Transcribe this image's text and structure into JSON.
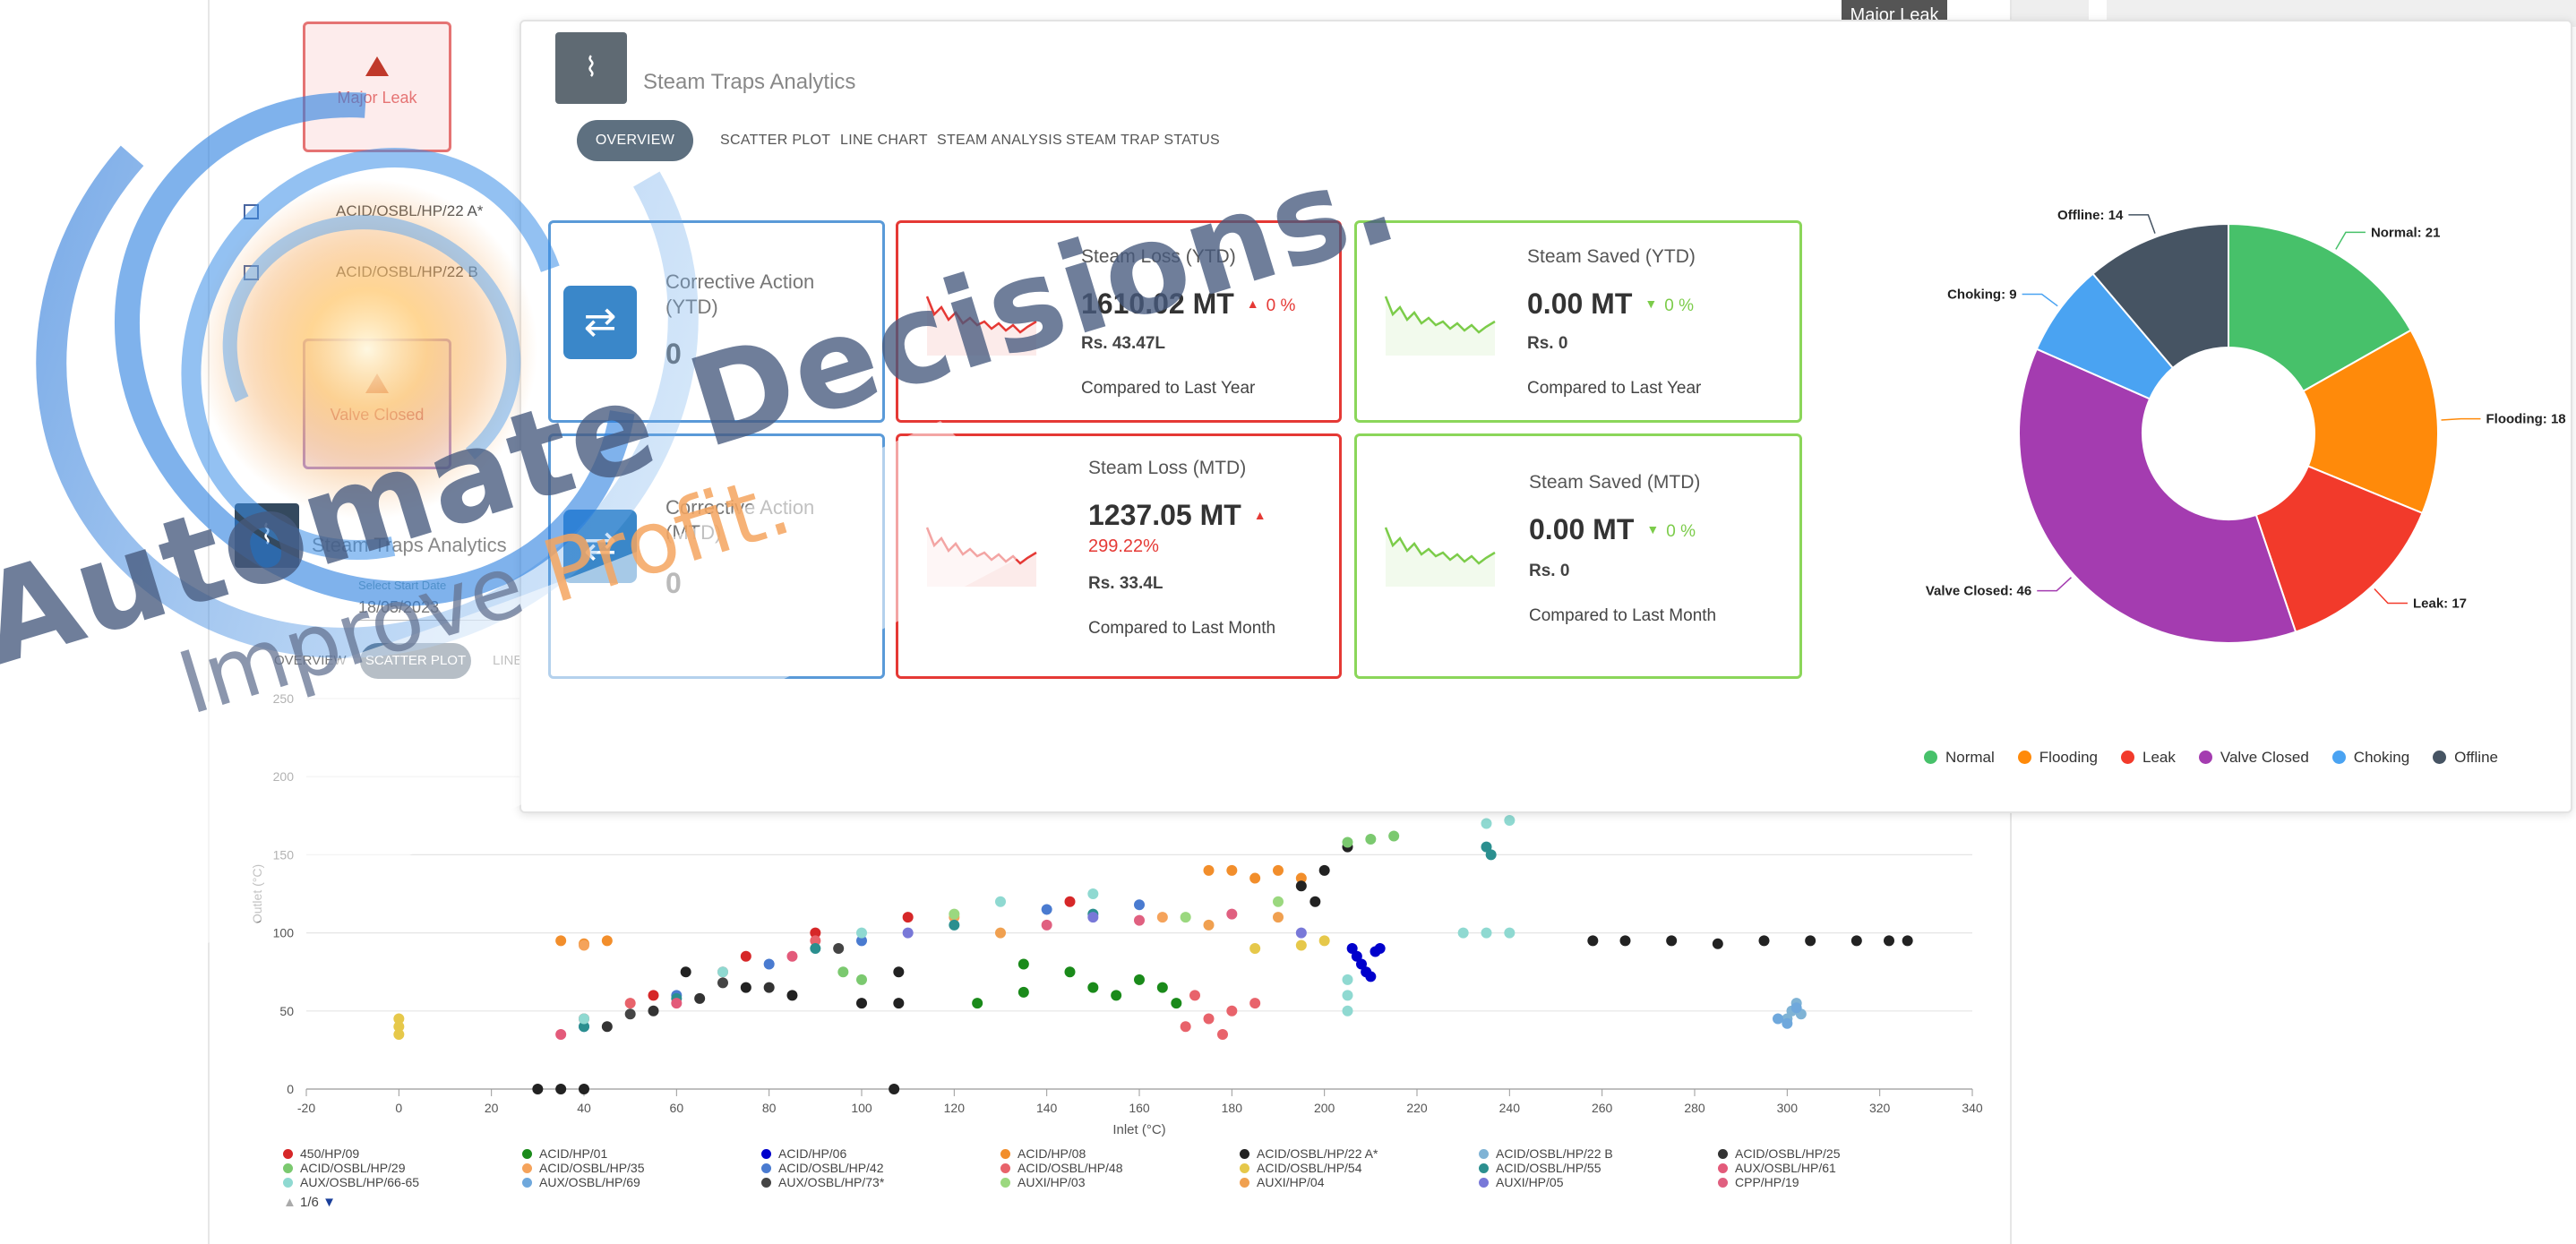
{
  "background_window": {
    "top_tag": "Major Leak",
    "cards": [
      {
        "label": "Major Leak"
      },
      {
        "label": "Valve Closed"
      }
    ],
    "trap_rows": [
      "ACID/OSBL/HP/22 A*",
      "ACID/OSBL/HP/22 B"
    ],
    "analytics_title": "Steam Traps Analytics",
    "start_date_label": "Select Start Date",
    "start_date_value": "18/05/2023",
    "tabs": [
      "OVERVIEW",
      "SCATTER PLOT",
      "LINE"
    ]
  },
  "chart_data": [
    {
      "type": "scatter",
      "title": "",
      "xlabel": "Inlet (°C)",
      "ylabel": "Outlet (°C)",
      "xlim": [
        -20,
        340
      ],
      "ylim": [
        0,
        250
      ],
      "x_ticks": [
        -20,
        0,
        20,
        40,
        60,
        80,
        100,
        120,
        140,
        160,
        180,
        200,
        220,
        240,
        260,
        280,
        300,
        320,
        340
      ],
      "y_ticks": [
        0,
        50,
        100,
        150,
        200,
        250
      ],
      "grid": true,
      "legend_page": "1/6",
      "series": [
        {
          "name": "450/HP/09",
          "color": "#d62728",
          "points": [
            [
              40,
              45
            ],
            [
              55,
              60
            ],
            [
              75,
              85
            ],
            [
              90,
              100
            ],
            [
              110,
              110
            ],
            [
              145,
              120
            ]
          ]
        },
        {
          "name": "ACID/HP/01",
          "color": "#1a8a1a",
          "points": [
            [
              135,
              80
            ],
            [
              145,
              75
            ],
            [
              150,
              65
            ],
            [
              155,
              60
            ],
            [
              160,
              70
            ],
            [
              165,
              65
            ],
            [
              168,
              55
            ],
            [
              135,
              62
            ],
            [
              125,
              55
            ]
          ]
        },
        {
          "name": "ACID/HP/06",
          "color": "#0000cc",
          "points": [
            [
              206,
              90
            ],
            [
              207,
              85
            ],
            [
              208,
              80
            ],
            [
              209,
              75
            ],
            [
              210,
              72
            ],
            [
              211,
              88
            ],
            [
              212,
              90
            ]
          ]
        },
        {
          "name": "ACID/HP/08",
          "color": "#f28e2b",
          "points": [
            [
              175,
              140
            ],
            [
              180,
              140
            ],
            [
              185,
              135
            ],
            [
              190,
              140
            ],
            [
              195,
              135
            ],
            [
              35,
              95
            ],
            [
              40,
              93
            ],
            [
              45,
              95
            ]
          ]
        },
        {
          "name": "ACID/OSBL/HP/22 A*",
          "color": "#222222",
          "points": [
            [
              30,
              0
            ],
            [
              35,
              0
            ],
            [
              40,
              0
            ],
            [
              107,
              0
            ],
            [
              62,
              75
            ],
            [
              75,
              65
            ],
            [
              85,
              60
            ],
            [
              100,
              55
            ],
            [
              108,
              55
            ],
            [
              108,
              75
            ],
            [
              195,
              130
            ],
            [
              198,
              120
            ],
            [
              200,
              140
            ],
            [
              205,
              155
            ],
            [
              258,
              95
            ],
            [
              265,
              95
            ],
            [
              275,
              95
            ],
            [
              285,
              93
            ],
            [
              295,
              95
            ],
            [
              305,
              95
            ],
            [
              315,
              95
            ],
            [
              322,
              95
            ],
            [
              326,
              95
            ]
          ]
        },
        {
          "name": "ACID/OSBL/HP/22 B",
          "color": "#7fb3d5",
          "points": [
            [
              300,
              45
            ],
            [
              301,
              50
            ],
            [
              302,
              55
            ],
            [
              303,
              48
            ]
          ]
        },
        {
          "name": "ACID/OSBL/HP/25",
          "color": "#333333",
          "points": [
            [
              45,
              40
            ],
            [
              55,
              50
            ],
            [
              65,
              58
            ],
            [
              80,
              65
            ]
          ]
        },
        {
          "name": "ACID/OSBL/HP/29",
          "color": "#7bc96f",
          "points": [
            [
              205,
              158
            ],
            [
              210,
              160
            ],
            [
              215,
              162
            ],
            [
              100,
              70
            ],
            [
              96,
              75
            ]
          ]
        },
        {
          "name": "ACID/OSBL/HP/35",
          "color": "#f5a35b",
          "points": [
            [
              40,
              92
            ],
            [
              120,
              110
            ],
            [
              165,
              110
            ]
          ]
        },
        {
          "name": "ACID/OSBL/HP/42",
          "color": "#4a7bd0",
          "points": [
            [
              40,
              40
            ],
            [
              60,
              60
            ],
            [
              80,
              80
            ],
            [
              100,
              95
            ],
            [
              140,
              115
            ],
            [
              160,
              118
            ]
          ]
        },
        {
          "name": "ACID/OSBL/HP/48",
          "color": "#e8636b",
          "points": [
            [
              50,
              55
            ],
            [
              70,
              75
            ],
            [
              90,
              95
            ],
            [
              170,
              40
            ],
            [
              175,
              45
            ],
            [
              180,
              50
            ],
            [
              178,
              35
            ],
            [
              185,
              55
            ],
            [
              172,
              60
            ]
          ]
        },
        {
          "name": "ACID/OSBL/HP/54",
          "color": "#e6c84a",
          "points": [
            [
              0,
              40
            ],
            [
              0,
              35
            ],
            [
              0,
              45
            ],
            [
              185,
              90
            ],
            [
              195,
              92
            ],
            [
              200,
              95
            ]
          ]
        },
        {
          "name": "ACID/OSBL/HP/55",
          "color": "#2b8f8f",
          "points": [
            [
              40,
              40
            ],
            [
              60,
              58
            ],
            [
              90,
              90
            ],
            [
              120,
              105
            ],
            [
              150,
              112
            ],
            [
              235,
              155
            ],
            [
              236,
              150
            ]
          ]
        },
        {
          "name": "AUX/OSBL/HP/61",
          "color": "#e35a7a",
          "points": [
            [
              35,
              35
            ],
            [
              60,
              55
            ],
            [
              85,
              85
            ]
          ]
        },
        {
          "name": "AUX/OSBL/HP/66-65",
          "color": "#8fd9d1",
          "points": [
            [
              40,
              45
            ],
            [
              70,
              75
            ],
            [
              100,
              100
            ],
            [
              130,
              120
            ],
            [
              150,
              125
            ],
            [
              230,
              100
            ],
            [
              235,
              100
            ],
            [
              240,
              100
            ],
            [
              205,
              70
            ],
            [
              205,
              60
            ],
            [
              205,
              50
            ],
            [
              235,
              170
            ],
            [
              240,
              172
            ]
          ]
        },
        {
          "name": "AUX/OSBL/HP/69",
          "color": "#6fa8dc",
          "points": [
            [
              298,
              45
            ],
            [
              300,
              42
            ],
            [
              302,
              52
            ]
          ]
        },
        {
          "name": "AUX/OSBL/HP/73*",
          "color": "#444444",
          "points": [
            [
              50,
              48
            ],
            [
              70,
              68
            ],
            [
              95,
              90
            ]
          ]
        },
        {
          "name": "AUXI/HP/03",
          "color": "#9bd87f",
          "points": [
            [
              120,
              112
            ],
            [
              170,
              110
            ],
            [
              190,
              120
            ]
          ]
        },
        {
          "name": "AUXI/HP/04",
          "color": "#f0a050",
          "points": [
            [
              130,
              100
            ],
            [
              175,
              105
            ],
            [
              190,
              110
            ]
          ]
        },
        {
          "name": "AUXI/HP/05",
          "color": "#7878d8",
          "points": [
            [
              110,
              100
            ],
            [
              150,
              110
            ],
            [
              195,
              100
            ]
          ]
        },
        {
          "name": "CPP/HP/19",
          "color": "#e06080",
          "points": [
            [
              140,
              105
            ],
            [
              160,
              108
            ],
            [
              180,
              112
            ]
          ]
        }
      ]
    },
    {
      "type": "pie",
      "donut": true,
      "title": "",
      "categories": [
        "Normal",
        "Flooding",
        "Leak",
        "Valve Closed",
        "Choking",
        "Offline"
      ],
      "values": [
        21,
        18,
        17,
        46,
        9,
        14
      ],
      "colors": [
        "#47c16a",
        "#ff8a0a",
        "#f23a2b",
        "#a43cb0",
        "#4aa3f2",
        "#465463"
      ],
      "labels": [
        "Normal: 21",
        "Flooding: 18",
        "Leak: 17",
        "Valve Closed: 46",
        "Choking: 9",
        "Offline: 14"
      ],
      "legend_placement": "bottom"
    }
  ],
  "front_window": {
    "title": "Steam Traps Analytics",
    "tabs": [
      "OVERVIEW",
      "SCATTER PLOT",
      "LINE CHART",
      "STEAM ANALYSIS",
      "STEAM TRAP STATUS"
    ],
    "kpis": {
      "ca_ytd": {
        "title": "Corrective Action (YTD)",
        "value": "0"
      },
      "ca_mtd": {
        "title": "Corrective Action (MTD)",
        "value": "0"
      },
      "loss_ytd": {
        "title": "Steam Loss (YTD)",
        "value": "1610.02 MT",
        "arrow": "▲",
        "pct": "0 %",
        "sub": "Rs. 43.47L",
        "compare": "Compared to Last Year"
      },
      "saved_ytd": {
        "title": "Steam Saved (YTD)",
        "value": "0.00 MT",
        "arrow": "▼",
        "pct": "0 %",
        "sub": "Rs. 0",
        "compare": "Compared to Last Year"
      },
      "loss_mtd": {
        "title": "Steam Loss (MTD)",
        "value": "1237.05 MT",
        "arrow": "▲",
        "pct": "299.22%",
        "sub": "Rs. 33.4L",
        "compare": "Compared to Last Month"
      },
      "saved_mtd": {
        "title": "Steam Saved (MTD)",
        "value": "0.00 MT",
        "arrow": "▼",
        "pct": "0 %",
        "sub": "Rs. 0",
        "compare": "Compared to Last Month"
      }
    },
    "icons": {
      "analytics": "trend-icon",
      "corrective_action": "swap-arrows-icon"
    },
    "colors": {
      "loss": "#e53935",
      "saved": "#7ccc4a",
      "action": "#3a87c9"
    }
  },
  "watermark": {
    "line1": "Automate Decisions.",
    "line2a": "Improve ",
    "line2b": "Profit."
  }
}
